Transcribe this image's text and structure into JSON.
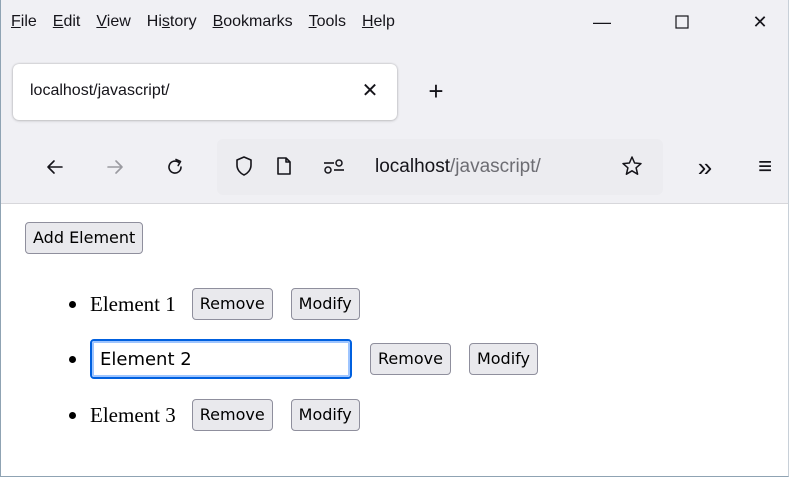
{
  "menubar": {
    "items": [
      {
        "label": "File",
        "accel": "F",
        "rest": "ile"
      },
      {
        "label": "Edit",
        "accel": "E",
        "rest": "dit"
      },
      {
        "label": "View",
        "accel": "V",
        "rest": "iew"
      },
      {
        "label": "History",
        "pre": "Hi",
        "accel": "s",
        "rest": "tory"
      },
      {
        "label": "Bookmarks",
        "accel": "B",
        "rest": "ookmarks"
      },
      {
        "label": "Tools",
        "accel": "T",
        "rest": "ools"
      },
      {
        "label": "Help",
        "accel": "H",
        "rest": "elp"
      }
    ],
    "window_controls": {
      "minimize": "—",
      "maximize": "☐",
      "close": "✕"
    }
  },
  "tabs": [
    {
      "title": "localhost/javascript/",
      "close": "✕",
      "active": true
    }
  ],
  "new_tab_label": "+",
  "navbar": {
    "back": "←",
    "forward": "→",
    "reload": "C",
    "url_host": "localhost",
    "url_path": "/javascript/",
    "more_tools": "»",
    "menu": "≡"
  },
  "page": {
    "add_button_label": "Add Element",
    "items": [
      {
        "text": "Element 1",
        "editing": false,
        "remove_label": "Remove",
        "modify_label": "Modify"
      },
      {
        "text": "Element 2",
        "editing": true,
        "remove_label": "Remove",
        "modify_label": "Modify"
      },
      {
        "text": "Element 3",
        "editing": false,
        "remove_label": "Remove",
        "modify_label": "Modify"
      }
    ]
  },
  "colors": {
    "chrome_bg": "#f0f0f4",
    "urlbar_bg": "#ececf0",
    "focus_blue": "#0060df",
    "button_bg": "#e9e9ed"
  }
}
